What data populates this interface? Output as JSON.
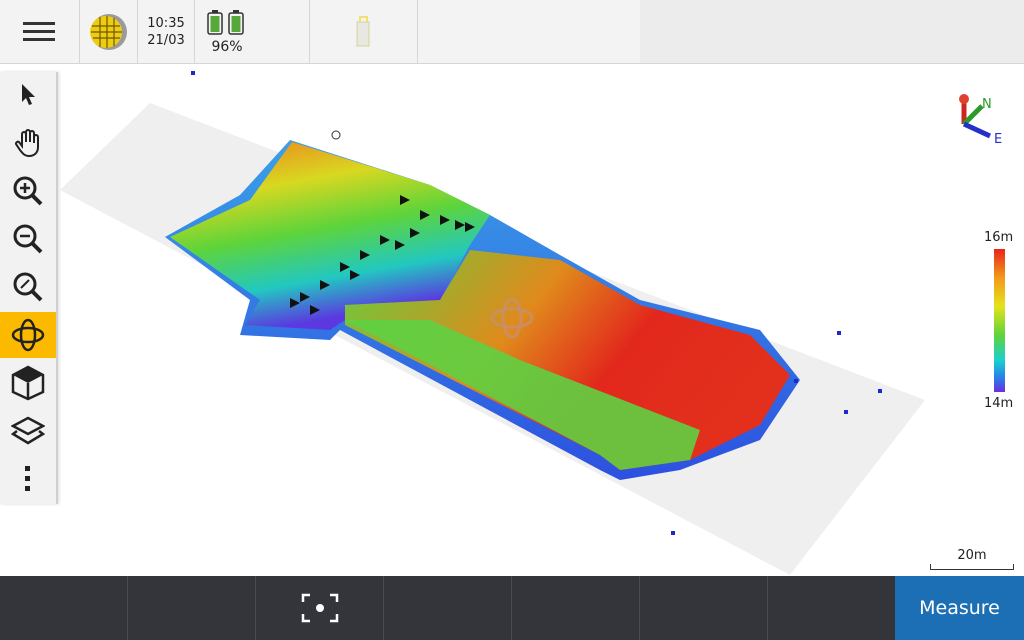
{
  "topbar": {
    "time": "10:35",
    "date": "21/03",
    "battery": "96%",
    "icons": [
      "menu-icon",
      "globe-icon",
      "battery-icon",
      "receiver-icon"
    ]
  },
  "toolbar": {
    "items": [
      {
        "name": "select",
        "icon": "pointer-icon"
      },
      {
        "name": "pan",
        "icon": "hand-icon"
      },
      {
        "name": "zoom-in",
        "icon": "zoom-in-icon"
      },
      {
        "name": "zoom-out",
        "icon": "zoom-out-icon"
      },
      {
        "name": "zoom-extents",
        "icon": "zoom-extents-icon"
      },
      {
        "name": "orbit",
        "icon": "orbit-icon",
        "active": true
      },
      {
        "name": "view",
        "icon": "cube-icon"
      },
      {
        "name": "layers",
        "icon": "layers-icon"
      },
      {
        "name": "more",
        "icon": "more-icon"
      }
    ]
  },
  "compass": {
    "north": "N",
    "east": "E"
  },
  "legend": {
    "max": "16m",
    "min": "14m",
    "colors": [
      "#e8241c",
      "#f29a1a",
      "#e6e21a",
      "#5ed43a",
      "#1ad0d0",
      "#2a7ee8",
      "#6a2fe0"
    ]
  },
  "scale": {
    "label": "20m"
  },
  "bottombar": {
    "measure": "Measure",
    "center_icon": "focus-icon"
  },
  "accent": "#fbb900"
}
